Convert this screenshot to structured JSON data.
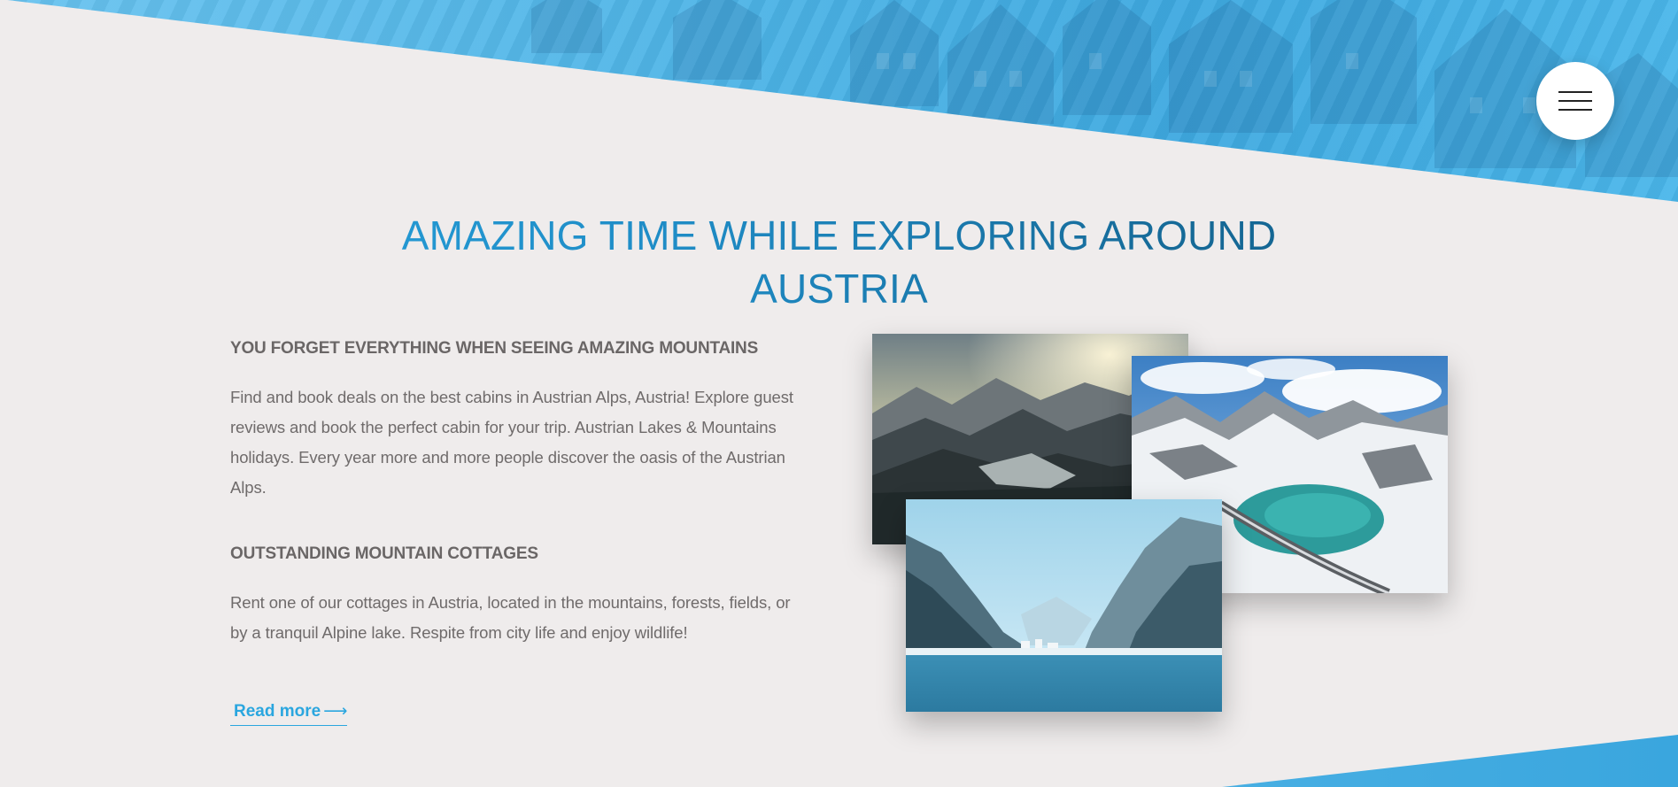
{
  "menu": {
    "icon": "hamburger-menu-icon"
  },
  "main": {
    "title": "AMAZING TIME WHILE EXPLORING AROUND AUSTRIA",
    "sections": [
      {
        "heading": "YOU FORGET EVERYTHING WHEN SEEING AMAZING MOUNTAINS",
        "body": "Find and book deals on the best cabins in Austrian Alps, Austria! Explore guest reviews and book the perfect cabin for your trip. Austrian Lakes & Mountains holidays. Every year more and more people discover the oasis of the Austrian Alps."
      },
      {
        "heading": "OUTSTANDING MOUNTAIN COTTAGES",
        "body": "Rent one of our cottages in Austria, located in the mountains, forests, fields, or by a tranquil Alpine lake. Respite from city life and enjoy wildlife!"
      }
    ],
    "read_more": {
      "label": "Read more",
      "arrow": "⟶"
    }
  },
  "gallery": {
    "photos": [
      {
        "subject": "mountain-valley-sunset"
      },
      {
        "subject": "snowy-mountain-reservoir"
      },
      {
        "subject": "alpine-lake-village"
      }
    ]
  },
  "colors": {
    "accent": "#2aa6df",
    "band": "#4cb3e6",
    "background": "#efecec",
    "text": "#6e6a6a"
  }
}
